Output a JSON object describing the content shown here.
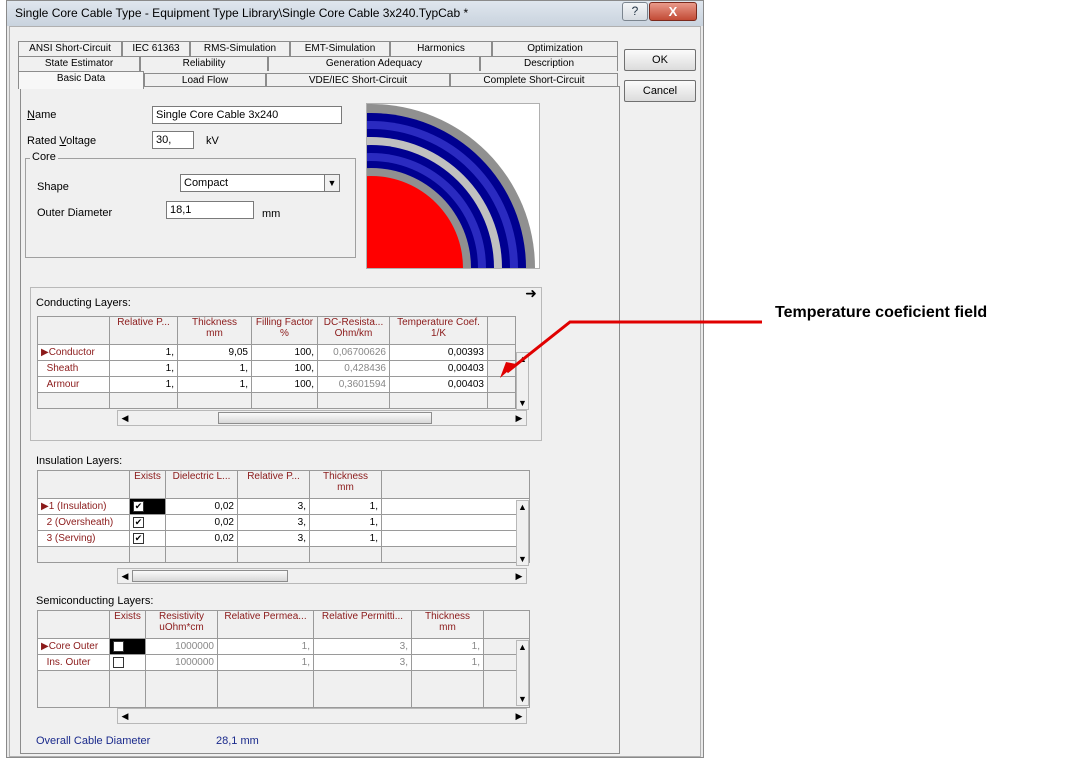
{
  "window": {
    "title": "Single Core Cable Type - Equipment Type Library\\Single Core Cable 3x240.TypCab *",
    "help_label": "?",
    "close_label": "X"
  },
  "tabs": {
    "row1": [
      "ANSI Short-Circuit",
      "IEC 61363",
      "RMS-Simulation",
      "EMT-Simulation",
      "Harmonics",
      "Optimization"
    ],
    "row2": [
      "State Estimator",
      "Reliability",
      "Generation Adequacy",
      "Description"
    ],
    "row3": [
      "Basic Data",
      "Load Flow",
      "VDE/IEC Short-Circuit",
      "Complete Short-Circuit"
    ],
    "active": "Basic Data"
  },
  "buttons": {
    "ok": "OK",
    "cancel": "Cancel"
  },
  "basic": {
    "name_label": "Name",
    "name_value": "Single Core Cable 3x240",
    "voltage_label": "Rated Voltage",
    "voltage_value": "30,",
    "voltage_unit": "kV",
    "core_group": "Core",
    "shape_label": "Shape",
    "shape_value": "Compact",
    "diameter_label": "Outer Diameter",
    "diameter_value": "18,1",
    "diameter_unit": "mm"
  },
  "conducting": {
    "title": "Conducting Layers:",
    "headers": [
      "",
      "Relative P...",
      "Thickness\nmm",
      "Filling Factor\n%",
      "DC-Resista...\nOhm/km",
      "Temperature Coef.\n1/K"
    ],
    "rows": [
      {
        "name": "Conductor",
        "rel": "1,",
        "thick": "9,05",
        "fill": "100,",
        "dc": "0,06700626",
        "temp": "0,00393"
      },
      {
        "name": "Sheath",
        "rel": "1,",
        "thick": "1,",
        "fill": "100,",
        "dc": "0,428436",
        "temp": "0,00403"
      },
      {
        "name": "Armour",
        "rel": "1,",
        "thick": "1,",
        "fill": "100,",
        "dc": "0,3601594",
        "temp": "0,00403"
      }
    ]
  },
  "insulation": {
    "title": "Insulation Layers:",
    "headers": [
      "",
      "Exists",
      "Dielectric L...",
      "Relative P...",
      "Thickness\nmm"
    ],
    "rows": [
      {
        "name": "1 (Insulation)",
        "exists": true,
        "diel": "0,02",
        "rel": "3,",
        "thick": "1,"
      },
      {
        "name": "2 (Oversheath)",
        "exists": true,
        "diel": "0,02",
        "rel": "3,",
        "thick": "1,"
      },
      {
        "name": "3 (Serving)",
        "exists": true,
        "diel": "0,02",
        "rel": "3,",
        "thick": "1,"
      }
    ]
  },
  "semi": {
    "title": "Semiconducting Layers:",
    "headers": [
      "",
      "Exists",
      "Resistivity\nuOhm*cm",
      "Relative Permea...",
      "Relative Permitti...",
      "Thickness\nmm"
    ],
    "rows": [
      {
        "name": "Core Outer",
        "exists": false,
        "res": "1000000",
        "perm": "1,",
        "permit": "3,",
        "thick": "1,"
      },
      {
        "name": "Ins. Outer",
        "exists": false,
        "res": "1000000",
        "perm": "1,",
        "permit": "3,",
        "thick": "1,"
      }
    ]
  },
  "overall": {
    "label": "Overall Cable Diameter",
    "value": "28,1 mm"
  },
  "annotation": "Temperature coeficient field",
  "colors": {
    "core": "#ff0000",
    "insulation_blue": "#000090",
    "ring_gray": "#909090",
    "annot_arrow": "#e00000",
    "accent_text": "#8b1a1a"
  }
}
